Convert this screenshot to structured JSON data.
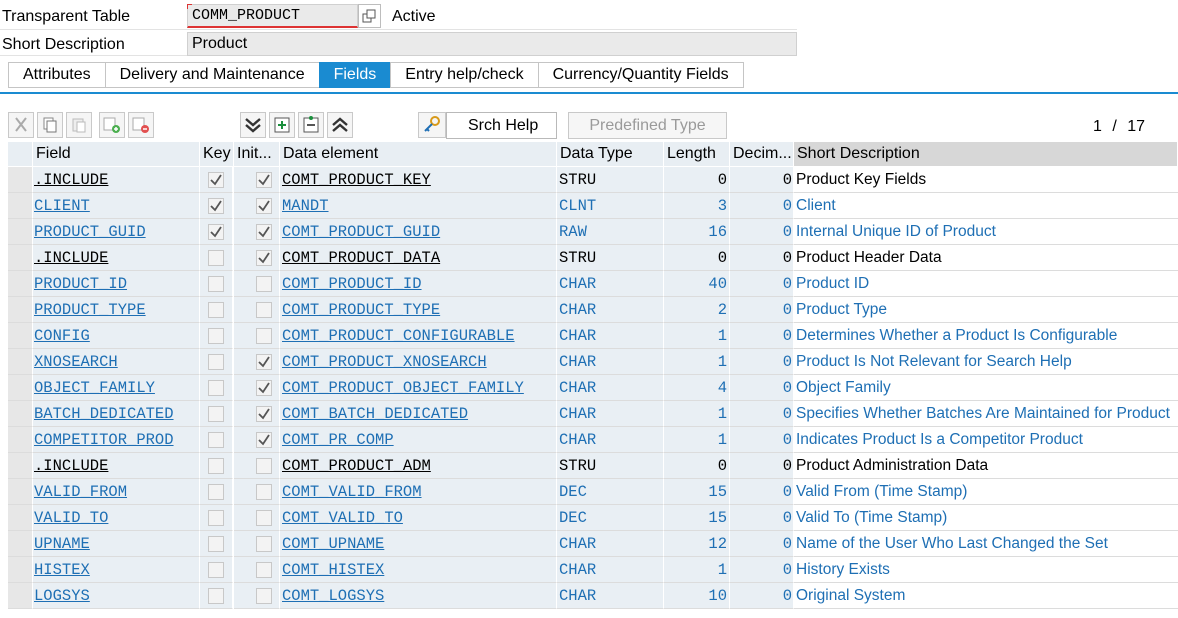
{
  "header": {
    "table_label": "Transparent Table",
    "table_name": "COMM_PRODUCT",
    "status": "Active",
    "short_desc_label": "Short Description",
    "short_desc_value": "Product"
  },
  "tabs": [
    {
      "label": "Attributes",
      "active": false
    },
    {
      "label": "Delivery and Maintenance",
      "active": false
    },
    {
      "label": "Fields",
      "active": true
    },
    {
      "label": "Entry help/check",
      "active": false
    },
    {
      "label": "Currency/Quantity Fields",
      "active": false
    }
  ],
  "toolbar": {
    "icons": [
      "cut-icon",
      "copy-icon",
      "paste-icon",
      "insert-row-icon",
      "delete-row-icon",
      "expand-all-icon",
      "insert-include-icon",
      "collapse-include-icon",
      "collapse-all-icon"
    ],
    "srch_help": "Srch Help",
    "predefined_type": "Predefined Type",
    "pager": "1 / 17"
  },
  "columns": {
    "field": "Field",
    "key": "Key",
    "init": "Init...",
    "data_element": "Data element",
    "data_type": "Data Type",
    "length": "Length",
    "decimals": "Decim...",
    "short_description": "Short Description"
  },
  "rows": [
    {
      "field": ".INCLUDE",
      "key": true,
      "init": true,
      "de": "COMT_PRODUCT_KEY",
      "dt": "STRU",
      "len": "0",
      "dec": "0",
      "desc": "Product Key Fields",
      "include": true
    },
    {
      "field": "CLIENT",
      "key": true,
      "init": true,
      "de": "MANDT",
      "dt": "CLNT",
      "len": "3",
      "dec": "0",
      "desc": "Client",
      "include": false
    },
    {
      "field": "PRODUCT_GUID",
      "key": true,
      "init": true,
      "de": "COMT_PRODUCT_GUID",
      "dt": "RAW",
      "len": "16",
      "dec": "0",
      "desc": "Internal Unique ID of Product",
      "include": false
    },
    {
      "field": ".INCLUDE",
      "key": false,
      "init": true,
      "de": "COMT_PRODUCT_DATA",
      "dt": "STRU",
      "len": "0",
      "dec": "0",
      "desc": "Product Header Data",
      "include": true
    },
    {
      "field": "PRODUCT_ID",
      "key": false,
      "init": false,
      "de": "COMT_PRODUCT_ID",
      "dt": "CHAR",
      "len": "40",
      "dec": "0",
      "desc": "Product ID",
      "include": false
    },
    {
      "field": "PRODUCT_TYPE",
      "key": false,
      "init": false,
      "de": "COMT_PRODUCT_TYPE",
      "dt": "CHAR",
      "len": "2",
      "dec": "0",
      "desc": "Product Type",
      "include": false
    },
    {
      "field": "CONFIG",
      "key": false,
      "init": false,
      "de": "COMT_PRODUCT_CONFIGURABLE",
      "dt": "CHAR",
      "len": "1",
      "dec": "0",
      "desc": "Determines Whether a Product Is Configurable",
      "include": false
    },
    {
      "field": "XNOSEARCH",
      "key": false,
      "init": true,
      "de": "COMT_PRODUCT_XNOSEARCH",
      "dt": "CHAR",
      "len": "1",
      "dec": "0",
      "desc": "Product Is Not Relevant for Search Help",
      "include": false
    },
    {
      "field": "OBJECT_FAMILY",
      "key": false,
      "init": true,
      "de": "COMT_PRODUCT_OBJECT_FAMILY",
      "dt": "CHAR",
      "len": "4",
      "dec": "0",
      "desc": "Object Family",
      "include": false
    },
    {
      "field": "BATCH_DEDICATED",
      "key": false,
      "init": true,
      "de": "COMT_BATCH_DEDICATED",
      "dt": "CHAR",
      "len": "1",
      "dec": "0",
      "desc": "Specifies Whether Batches Are Maintained for Product",
      "include": false
    },
    {
      "field": "COMPETITOR_PROD",
      "key": false,
      "init": true,
      "de": "COMT_PR_COMP",
      "dt": "CHAR",
      "len": "1",
      "dec": "0",
      "desc": "Indicates Product Is a Competitor Product",
      "include": false
    },
    {
      "field": ".INCLUDE",
      "key": false,
      "init": false,
      "de": "COMT_PRODUCT_ADM",
      "dt": "STRU",
      "len": "0",
      "dec": "0",
      "desc": "Product Administration Data",
      "include": true
    },
    {
      "field": "VALID_FROM",
      "key": false,
      "init": false,
      "de": "COMT_VALID_FROM",
      "dt": "DEC",
      "len": "15",
      "dec": "0",
      "desc": "Valid From (Time Stamp)",
      "include": false
    },
    {
      "field": "VALID_TO",
      "key": false,
      "init": false,
      "de": "COMT_VALID_TO",
      "dt": "DEC",
      "len": "15",
      "dec": "0",
      "desc": "Valid To (Time Stamp)",
      "include": false
    },
    {
      "field": "UPNAME",
      "key": false,
      "init": false,
      "de": "COMT_UPNAME",
      "dt": "CHAR",
      "len": "12",
      "dec": "0",
      "desc": "Name of the User Who Last Changed the Set",
      "include": false
    },
    {
      "field": "HISTEX",
      "key": false,
      "init": false,
      "de": "COMT_HISTEX",
      "dt": "CHAR",
      "len": "1",
      "dec": "0",
      "desc": "History Exists",
      "include": false
    },
    {
      "field": "LOGSYS",
      "key": false,
      "init": false,
      "de": "COMT_LOGSYS",
      "dt": "CHAR",
      "len": "10",
      "dec": "0",
      "desc": "Original System",
      "include": false
    }
  ]
}
